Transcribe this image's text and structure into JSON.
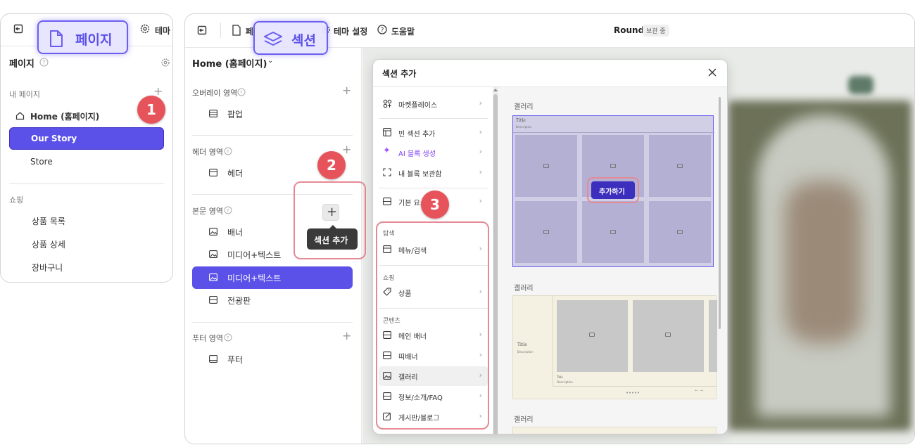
{
  "page_panel": {
    "toolbar_tab_label": "테마",
    "callout_label": "페이지",
    "title": "페이지",
    "my_pages_label": "내 페이지",
    "pages": [
      "Home (홈페이지)",
      "Our Story",
      "Store"
    ],
    "shopping_label": "쇼핑",
    "shopping_pages": [
      "상품 목록",
      "상품 상세",
      "장바구니"
    ]
  },
  "header": {
    "tab_page_partial": "페",
    "callout_label": "섹션",
    "theme_settings": "테마 설정",
    "help": "도움말",
    "site_name": "Round",
    "status_badge": "보관 중"
  },
  "section_panel": {
    "page_selector": "Home (홈페이지)",
    "groups": [
      {
        "label": "오버레이 영역",
        "items": [
          "팝업"
        ]
      },
      {
        "label": "헤더 영역",
        "items": [
          "헤더"
        ]
      },
      {
        "label": "본문 영역",
        "items": [
          "배너",
          "미디어+텍스트",
          "미디어+텍스트",
          "전광판"
        ]
      },
      {
        "label": "푸터 영역",
        "items": [
          "푸터"
        ]
      }
    ],
    "tooltip": "섹션 추가"
  },
  "modal": {
    "title": "섹션 추가",
    "top_items": [
      "마켓플레이스",
      "빈 섹션 추가",
      "AI 블록 생성",
      "내 블록 보관함",
      "기본 요소"
    ],
    "groups": [
      {
        "label": "탐색",
        "items": [
          "메뉴/검색"
        ]
      },
      {
        "label": "쇼핑",
        "items": [
          "상품"
        ]
      },
      {
        "label": "콘텐츠",
        "items": [
          "메인 배너",
          "띠배너",
          "갤러리",
          "정보/소개/FAQ",
          "게시판/블로그"
        ]
      }
    ],
    "preview_labels": [
      "갤러리",
      "갤러리",
      "갤러리"
    ],
    "add_button": "추가하기",
    "thumb1_title": "Title",
    "thumb1_desc": "Description",
    "thumb2_title": "Title",
    "thumb2_desc": "Description",
    "thumb2_card_title": "Title",
    "thumb2_card_desc": "Description"
  },
  "badges": [
    "1",
    "2",
    "3"
  ],
  "colors": {
    "accent": "#5b50e8",
    "badge": "#e7535b",
    "highlight": "#e58a95"
  }
}
